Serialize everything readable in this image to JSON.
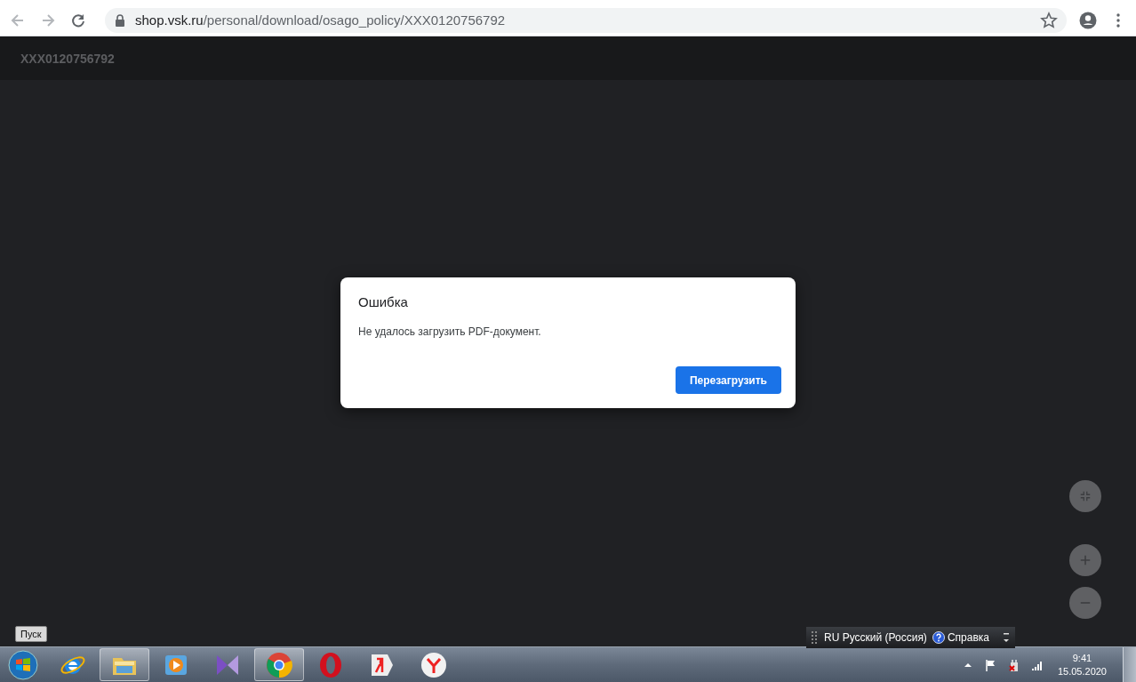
{
  "browser": {
    "url_host": "shop.vsk.ru",
    "url_path": "/personal/download/osago_policy/XXX0120756792"
  },
  "viewer": {
    "title": "XXX0120756792"
  },
  "dialog": {
    "title": "Ошибка",
    "message": "Не удалось загрузить PDF-документ.",
    "button": "Перезагрузить"
  },
  "zoom_controls": [
    {
      "kind": "fit"
    },
    {
      "kind": "plus"
    },
    {
      "kind": "minus"
    }
  ],
  "tooltip": "Пуск",
  "language_bar": {
    "language": "RU Русский (Россия)",
    "help": "Справка"
  },
  "taskbar": {
    "items": [
      {
        "kind": "ie",
        "open": false
      },
      {
        "kind": "folder",
        "open": true
      },
      {
        "kind": "media",
        "open": false
      },
      {
        "kind": "vs",
        "open": false
      },
      {
        "kind": "chrome",
        "open": true
      },
      {
        "kind": "opera",
        "open": false
      },
      {
        "kind": "yandex",
        "open": false
      },
      {
        "kind": "yabrowser",
        "open": false
      }
    ],
    "time": "9:41",
    "date": "15.05.2020"
  }
}
